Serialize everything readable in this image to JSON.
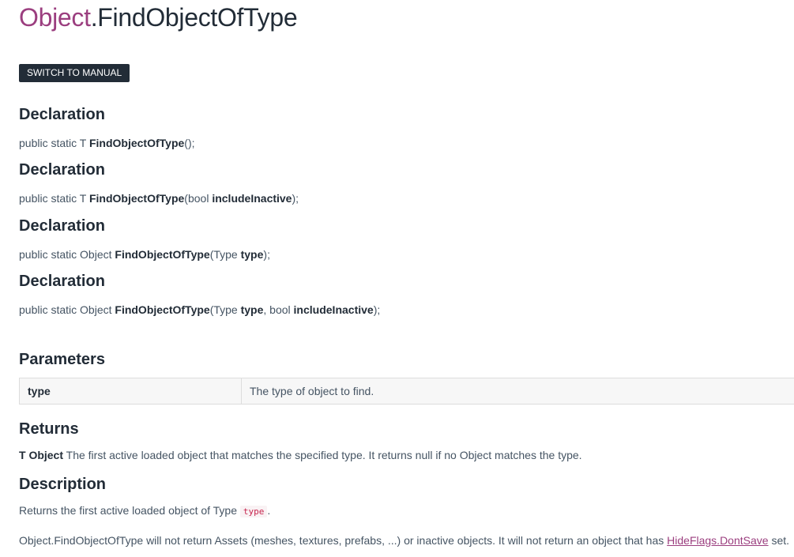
{
  "title": {
    "class_name": "Object",
    "separator": ".",
    "method_name": "FindObjectOfType"
  },
  "switch_button": "SWITCH TO MANUAL",
  "declarations": [
    {
      "heading": "Declaration",
      "prefix": "public static T ",
      "method": "FindObjectOfType",
      "signature": "();",
      "parts": []
    },
    {
      "heading": "Declaration",
      "prefix": "public static T ",
      "method": "FindObjectOfType",
      "open": "(bool ",
      "param1": "includeInactive",
      "close": ");"
    },
    {
      "heading": "Declaration",
      "prefix": "public static Object ",
      "method": "FindObjectOfType",
      "open": "(Type ",
      "param1": "type",
      "close": ");"
    },
    {
      "heading": "Declaration",
      "prefix": "public static Object ",
      "method": "FindObjectOfType",
      "open": "(Type ",
      "param1": "type",
      "mid": ", bool ",
      "param2": "includeInactive",
      "close": ");"
    }
  ],
  "parameters": {
    "heading": "Parameters",
    "rows": [
      {
        "name": "type",
        "description": "The type of object to find."
      }
    ]
  },
  "returns": {
    "heading": "Returns",
    "type": "T Object",
    "text": " The first active loaded object that matches the specified type. It returns null if no Object matches the type."
  },
  "description": {
    "heading": "Description",
    "line1_before": "Returns the first active loaded object of Type ",
    "line1_code": "type",
    "line1_after": ".",
    "line2_before": "Object.FindObjectOfType will not return Assets (meshes, textures, prefabs, ...) or inactive objects. It will not return an object that has ",
    "line2_link": "HideFlags.DontSave",
    "line2_after": " set."
  }
}
